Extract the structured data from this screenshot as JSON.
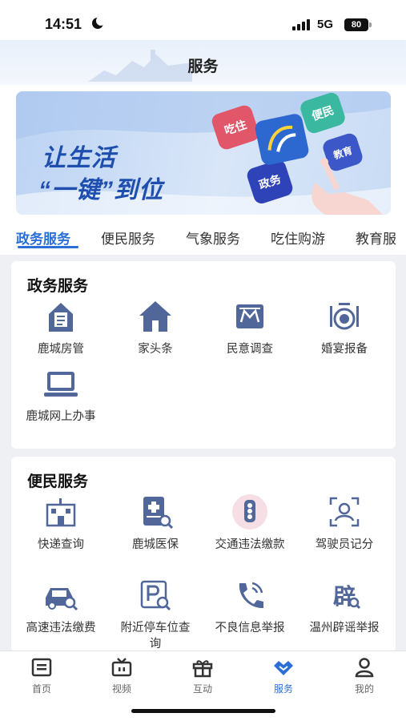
{
  "status_bar": {
    "time": "14:51",
    "network": "5G",
    "battery": "80"
  },
  "header": {
    "title": "服务"
  },
  "banner": {
    "line1": "让生活",
    "line2": "“一键”到位",
    "bubbles": [
      "吃住",
      "便民",
      "教育",
      "政务"
    ]
  },
  "tabs": [
    {
      "label": "政务服务",
      "active": true
    },
    {
      "label": "便民服务",
      "active": false
    },
    {
      "label": "气象服务",
      "active": false
    },
    {
      "label": "吃住购游",
      "active": false
    },
    {
      "label": "教育服",
      "active": false
    }
  ],
  "gov_section": {
    "title": "政务服务",
    "items": [
      {
        "label": "鹿城房管",
        "icon": "clipboard-house-icon"
      },
      {
        "label": "家头条",
        "icon": "house-icon"
      },
      {
        "label": "民意调查",
        "icon": "survey-board-icon"
      },
      {
        "label": "婚宴报备",
        "icon": "dining-plate-icon"
      },
      {
        "label": "鹿城网上办事",
        "icon": "laptop-icon"
      }
    ]
  },
  "life_section": {
    "title": "便民服务",
    "items": [
      {
        "label": "快递查询",
        "icon": "building-icon"
      },
      {
        "label": "鹿城医保",
        "icon": "medical-card-icon"
      },
      {
        "label": "交通违法缴款",
        "icon": "traffic-light-icon"
      },
      {
        "label": "驾驶员记分",
        "icon": "driver-id-icon"
      },
      {
        "label": "高速违法缴费",
        "icon": "car-search-icon"
      },
      {
        "label": "附近停车位查询",
        "icon": "parking-search-icon"
      },
      {
        "label": "不良信息举报",
        "icon": "phone-call-icon"
      },
      {
        "label": "温州辟谣举报",
        "icon": "rumor-char-icon"
      }
    ]
  },
  "bottom_nav": [
    {
      "label": "首页",
      "icon": "home-doc-icon",
      "active": false
    },
    {
      "label": "视频",
      "icon": "tv-icon",
      "active": false
    },
    {
      "label": "互动",
      "icon": "gift-icon",
      "active": false
    },
    {
      "label": "服务",
      "icon": "heart-diamond-icon",
      "active": true
    },
    {
      "label": "我的",
      "icon": "person-icon",
      "active": false
    }
  ],
  "colors": {
    "accent": "#2b6fd6",
    "icon": "#51679a",
    "banner_text": "#1f4fae"
  }
}
